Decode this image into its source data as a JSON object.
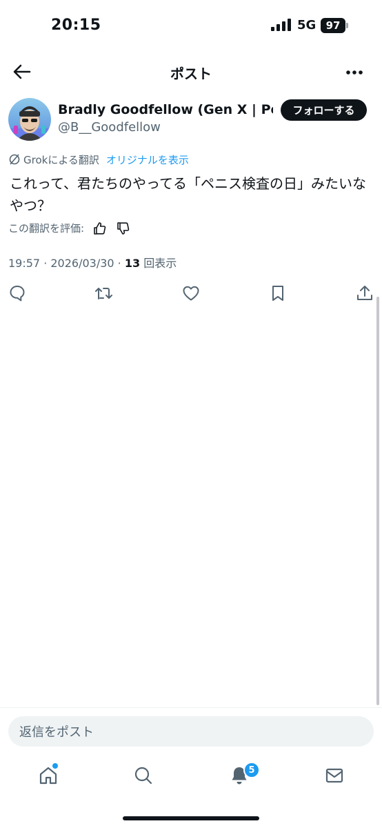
{
  "status_bar": {
    "time": "20:15",
    "network": "5G",
    "battery": "97"
  },
  "header": {
    "title": "ポスト",
    "back_icon": "arrow-left-icon",
    "more_icon": "more-horizontal-icon"
  },
  "author": {
    "name": "Bradly Goodfellow (Gen X | Po...",
    "handle": "@B__Goodfellow",
    "follow_label": "フォローする"
  },
  "post": {
    "translation_label": "Grokによる翻訳",
    "show_original_label": "オリジナルを表示",
    "text": "これって、君たちのやってる「ペニス検査の日」みたいなやつ？",
    "rate_label": "この翻訳を評価:",
    "timestamp": "19:57 · 2026/03/30 · ",
    "views_count": "13",
    "views_label": " 回表示"
  },
  "actions": [
    "reply-icon",
    "repost-icon",
    "like-icon",
    "bookmark-icon",
    "share-icon"
  ],
  "reply_box": {
    "placeholder": "返信をポスト"
  },
  "tab_bar": {
    "items": [
      "home-icon",
      "search-icon",
      "notifications-icon",
      "messages-icon"
    ],
    "notification_count": "5"
  },
  "colors": {
    "accent": "#1d9bf0",
    "text": "#0f1419",
    "secondary": "#536471"
  }
}
